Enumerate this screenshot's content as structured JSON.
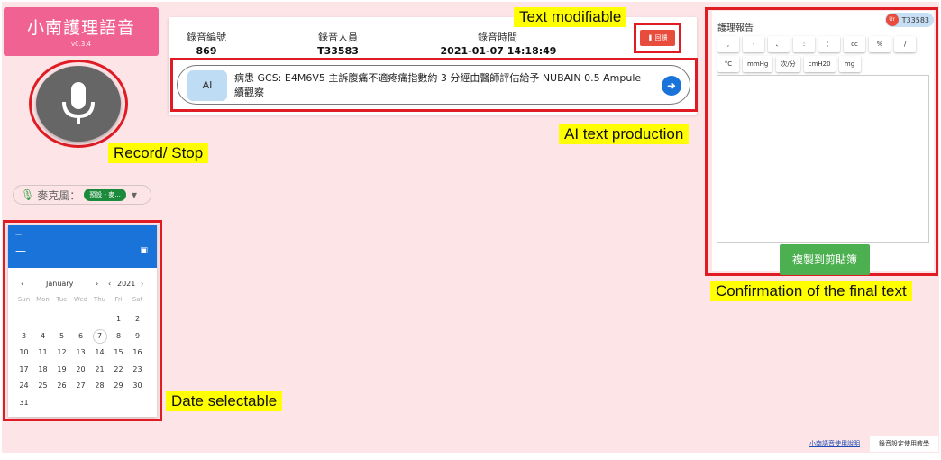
{
  "app": {
    "title": "小南護理語音",
    "version": "v0.3.4"
  },
  "mic_selector": {
    "label": "麥克風：",
    "value": "預設 - 麥..."
  },
  "calendar": {
    "header_small": "—",
    "header_big": "—",
    "month": "January",
    "year": "2021",
    "weekdays": [
      "Sun",
      "Mon",
      "Tue",
      "Wed",
      "Thu",
      "Fri",
      "Sat"
    ],
    "days": [
      "",
      "",
      "",
      "",
      "",
      "1",
      "2",
      "3",
      "4",
      "5",
      "6",
      "7",
      "8",
      "9",
      "10",
      "11",
      "12",
      "13",
      "14",
      "15",
      "16",
      "17",
      "18",
      "19",
      "20",
      "21",
      "22",
      "23",
      "24",
      "25",
      "26",
      "27",
      "28",
      "29",
      "30",
      "31",
      "",
      "",
      "",
      "",
      "",
      ""
    ],
    "highlighted_day": "7"
  },
  "record_info": {
    "id_label": "錄音編號",
    "id_value": "869",
    "user_label": "錄音人員",
    "user_value": "T33583",
    "time_label": "錄音時間",
    "time_value": "2021-01-07 14:18:49",
    "edit_label": "回饋"
  },
  "ai": {
    "badge": "AI",
    "text": "病患 GCS: E4M6V5 主訴腹痛不適疼痛指數約 3 分經由醫師評估給予 NUBAIN 0.5 Ampule 續觀察"
  },
  "report": {
    "title": "護理報告",
    "user_chip": {
      "avatar": "Ur",
      "name": "T33583"
    },
    "symbols_row1": [
      ",",
      "·",
      "、",
      ":",
      "：",
      "cc",
      "%",
      "/"
    ],
    "symbols_row2": [
      "°C",
      "mmHg",
      "次/分",
      "cmH20",
      "mg"
    ],
    "copy_label": "複製到剪貼簿"
  },
  "footer": {
    "help_link": "小南語音使用說明",
    "setting_button": "錄音設定使用教學"
  },
  "callouts": {
    "text_modifiable": "Text modifiable",
    "record_stop": "Record/ Stop",
    "ai_text": "AI text production",
    "date_selectable": "Date selectable",
    "confirmation": "Confirmation of the final text"
  }
}
